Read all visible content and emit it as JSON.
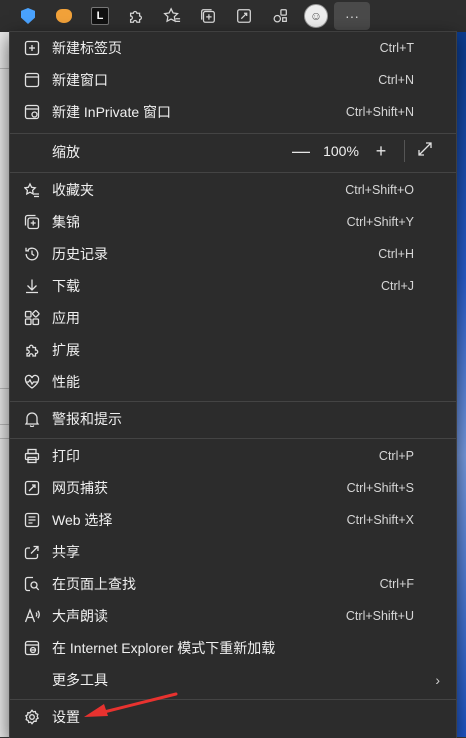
{
  "toolbar": {
    "overflow_label": "···"
  },
  "menu": {
    "items": [
      {
        "label": "新建标签页",
        "shortcut": "Ctrl+T"
      },
      {
        "label": "新建窗口",
        "shortcut": "Ctrl+N"
      },
      {
        "label": "新建 InPrivate 窗口",
        "shortcut": "Ctrl+Shift+N"
      },
      {
        "label": "缩放"
      },
      {
        "label": "收藏夹",
        "shortcut": "Ctrl+Shift+O"
      },
      {
        "label": "集锦",
        "shortcut": "Ctrl+Shift+Y"
      },
      {
        "label": "历史记录",
        "shortcut": "Ctrl+H"
      },
      {
        "label": "下载",
        "shortcut": "Ctrl+J"
      },
      {
        "label": "应用"
      },
      {
        "label": "扩展"
      },
      {
        "label": "性能"
      },
      {
        "label": "警报和提示"
      },
      {
        "label": "打印",
        "shortcut": "Ctrl+P"
      },
      {
        "label": "网页捕获",
        "shortcut": "Ctrl+Shift+S"
      },
      {
        "label": "Web 选择",
        "shortcut": "Ctrl+Shift+X"
      },
      {
        "label": "共享"
      },
      {
        "label": "在页面上查找",
        "shortcut": "Ctrl+F"
      },
      {
        "label": "大声朗读",
        "shortcut": "Ctrl+Shift+U"
      },
      {
        "label": "在 Internet Explorer 模式下重新加载"
      },
      {
        "label": "更多工具"
      },
      {
        "label": "设置"
      }
    ],
    "zoom": {
      "minus": "—",
      "value": "100%",
      "plus": "+"
    }
  },
  "colors": {
    "menu_bg": "#2c2c2c",
    "annotation_arrow": "#e8322f"
  }
}
